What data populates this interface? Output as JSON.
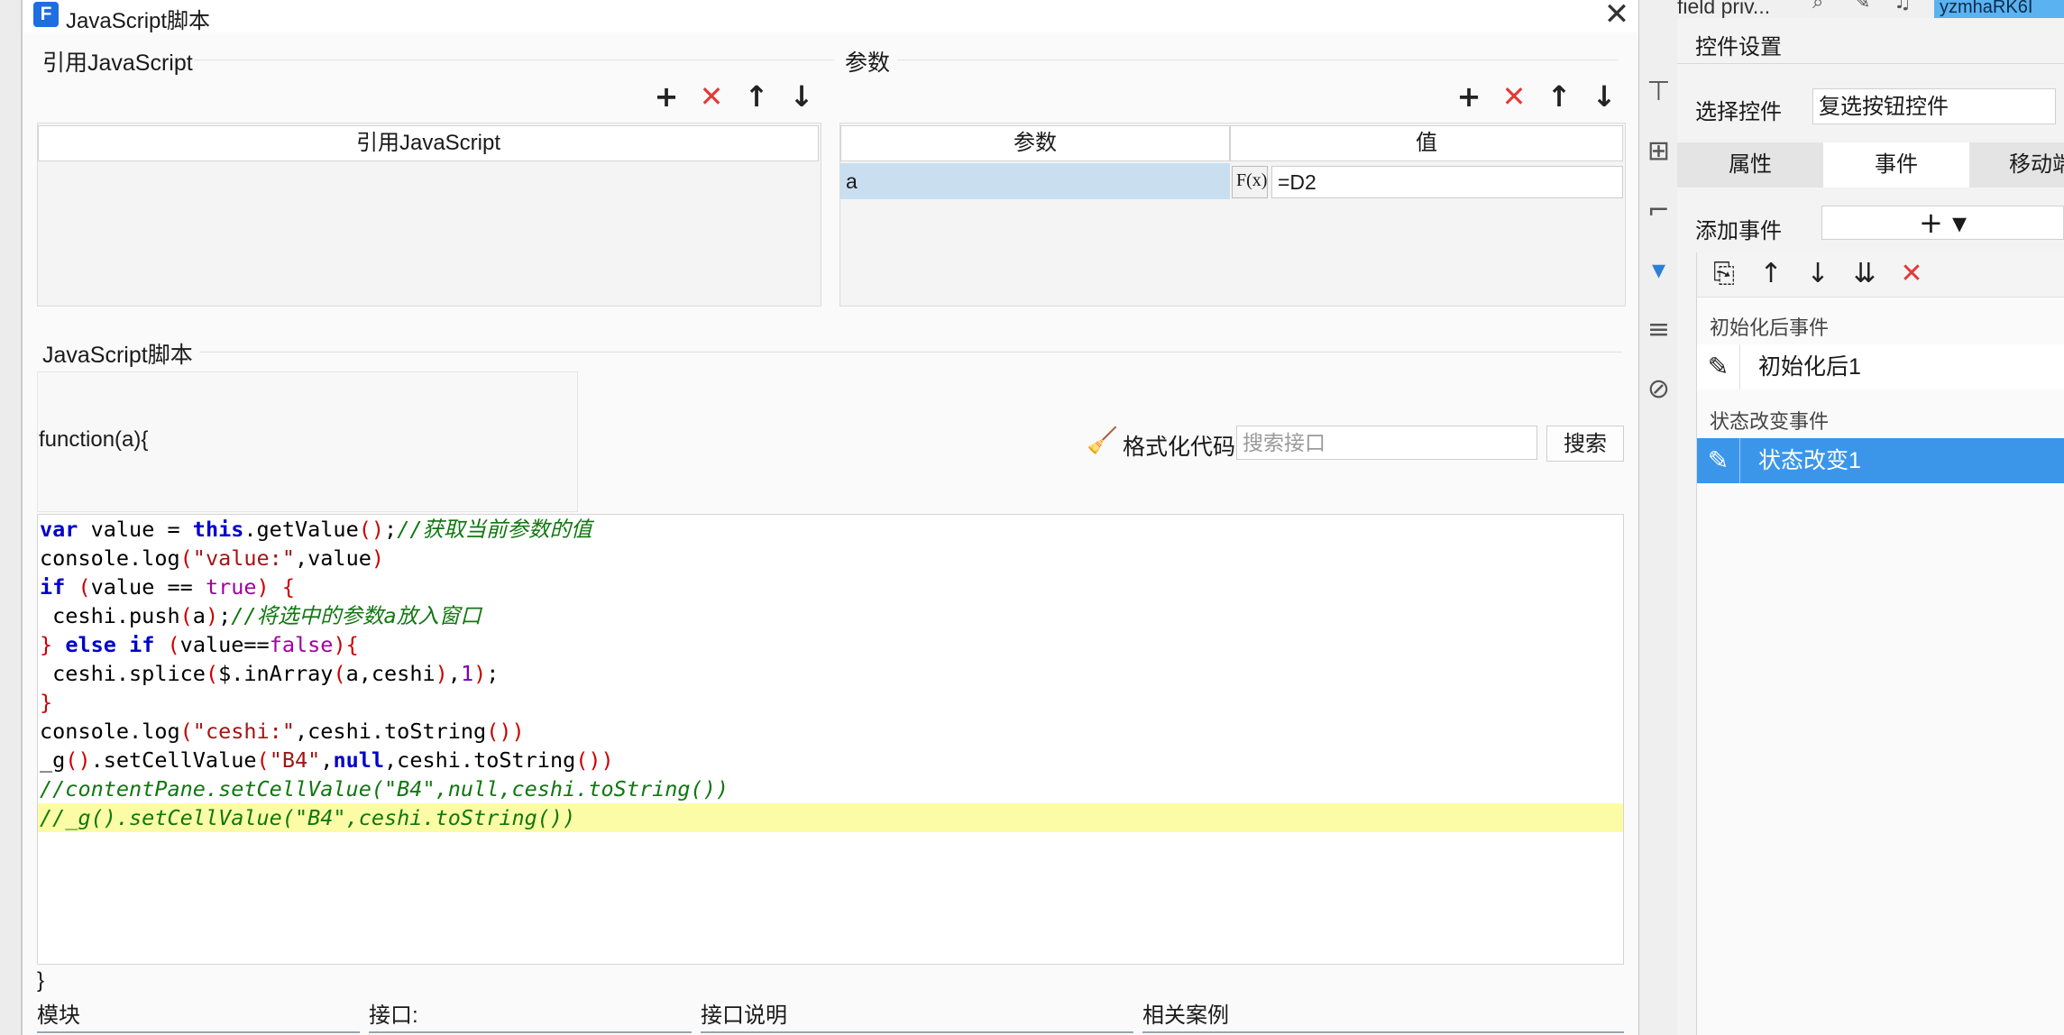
{
  "dialog": {
    "title": "JavaScript脚本",
    "logo_letter": "F",
    "close_label": "✕",
    "ref_group_label": "引用JavaScript",
    "ref_table_header": "引用JavaScript",
    "param_group_label": "参数",
    "param_table_headers": [
      "参数",
      "值"
    ],
    "param_rows": [
      {
        "name": "a",
        "fx_label": "F(x)",
        "value": "=D2"
      }
    ],
    "toolbar_labels": {
      "add": "+",
      "delete": "✕",
      "up": "↑",
      "down": "↓"
    },
    "script_group_label": "JavaScript脚本",
    "func_header": "function(a){",
    "func_footer": "}",
    "format_code_label": "格式化代码",
    "search_placeholder": "搜索接口",
    "search_button": "搜索",
    "code_lines": [
      [
        [
          "kw",
          "var"
        ],
        [
          "plain",
          " value = "
        ],
        [
          "kw",
          "this"
        ],
        [
          "plain",
          ".getValue"
        ],
        [
          "pun",
          "()"
        ],
        [
          "plain",
          ";"
        ],
        [
          "cm",
          "//获取当前参数的值"
        ]
      ],
      [
        [
          "plain",
          "console.log"
        ],
        [
          "pun",
          "("
        ],
        [
          "str",
          "\"value:\""
        ],
        [
          "plain",
          ",value"
        ],
        [
          "pun",
          ")"
        ]
      ],
      [
        [
          "kw",
          "if"
        ],
        [
          "plain",
          " "
        ],
        [
          "pun",
          "("
        ],
        [
          "plain",
          "value == "
        ],
        [
          "lit",
          "true"
        ],
        [
          "pun",
          ")"
        ],
        [
          "plain",
          " "
        ],
        [
          "pun",
          "{"
        ]
      ],
      [
        [
          "plain",
          " ceshi.push"
        ],
        [
          "pun",
          "("
        ],
        [
          "plain",
          "a"
        ],
        [
          "pun",
          ")"
        ],
        [
          "plain",
          ";"
        ],
        [
          "cm",
          "//将选中的参数a放入窗口"
        ]
      ],
      [
        [
          "pun",
          "}"
        ],
        [
          "plain",
          " "
        ],
        [
          "kw",
          "else"
        ],
        [
          "plain",
          " "
        ],
        [
          "kw",
          "if"
        ],
        [
          "plain",
          " "
        ],
        [
          "pun",
          "("
        ],
        [
          "plain",
          "value=="
        ],
        [
          "lit",
          "false"
        ],
        [
          "pun",
          ")"
        ],
        [
          "pun",
          "{"
        ]
      ],
      [
        [
          "plain",
          " ceshi.splice"
        ],
        [
          "pun",
          "("
        ],
        [
          "plain",
          "$.inArray"
        ],
        [
          "pun",
          "("
        ],
        [
          "plain",
          "a,ceshi"
        ],
        [
          "pun",
          ")"
        ],
        [
          "plain",
          ","
        ],
        [
          "num",
          "1"
        ],
        [
          "pun",
          ")"
        ],
        [
          "plain",
          ";"
        ]
      ],
      [
        [
          "pun",
          "}"
        ]
      ],
      [
        [
          "plain",
          "console.log"
        ],
        [
          "pun",
          "("
        ],
        [
          "str",
          "\"ceshi:\""
        ],
        [
          "plain",
          ",ceshi.toString"
        ],
        [
          "pun",
          "())"
        ]
      ],
      [
        [
          "plain",
          "_g"
        ],
        [
          "pun",
          "()"
        ],
        [
          "plain",
          ".setCellValue"
        ],
        [
          "pun",
          "("
        ],
        [
          "str",
          "\"B4\""
        ],
        [
          "plain",
          ","
        ],
        [
          "kw",
          "null"
        ],
        [
          "plain",
          ",ceshi.toString"
        ],
        [
          "pun",
          "())"
        ]
      ],
      [
        [
          "cm",
          "//contentPane.setCellValue(\"B4\",null,ceshi.toString())"
        ]
      ],
      [
        [
          "cm",
          "//_g().setCellValue(\"B4\",ceshi.toString())"
        ]
      ]
    ],
    "bottom_labels": [
      "模块",
      "接口:",
      "接口说明",
      "相关案例"
    ]
  },
  "right_panel": {
    "top_fragment": "field priv...",
    "top_user": "yzmhaRK6I",
    "header": "控件设置",
    "select_label": "选择控件",
    "select_value": "复选按钮控件",
    "tabs": [
      "属性",
      "事件",
      "移动端"
    ],
    "active_tab": "事件",
    "add_event_label": "添加事件",
    "add_event_button": "+ ▾",
    "event_sections": [
      {
        "title": "初始化后事件",
        "items": [
          "初始化后1"
        ]
      },
      {
        "title": "状态改变事件",
        "items": [
          "状态改变1"
        ]
      }
    ],
    "edit_icon_glyph": "✎"
  },
  "colors": {
    "selected_row": "#3b96ea",
    "param_selected": "#c9dff0",
    "highlight_line": "#fcfca6",
    "delete_red": "#e53935"
  }
}
